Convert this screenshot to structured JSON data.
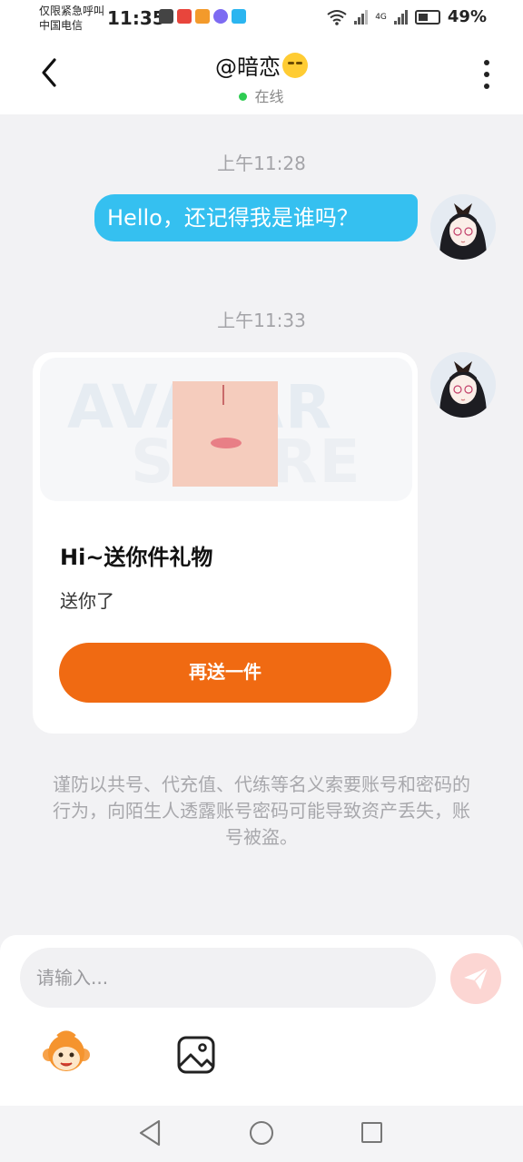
{
  "status_bar": {
    "carrier_line1": "仅限紧急呼叫",
    "carrier_line2": "中国电信",
    "time": "11:35",
    "battery": "49%",
    "network": "4G"
  },
  "header": {
    "title": "@暗恋",
    "status": "在线"
  },
  "messages": [
    {
      "time": "上午11:28",
      "type": "text",
      "text": "Hello，还记得我是谁吗？"
    },
    {
      "time": "上午11:33",
      "type": "gift",
      "banner_watermark_1": "AVATAR",
      "banner_watermark_2": "STORE",
      "title": "Hi~送你件礼物",
      "subtitle": "送你了",
      "button": "再送一件"
    }
  ],
  "notice": "谨防以共号、代充值、代练等名义索要账号和密码的行为，向陌生人透露账号密码可能导致资产丢失，账号被盗。",
  "input": {
    "placeholder": "请输入..."
  },
  "colors": {
    "bubble": "#35c0f0",
    "gift_button": "#f06a12",
    "online_dot": "#2ecc52",
    "send_button": "#fcd6d3"
  },
  "icons": [
    "back-arrow-icon",
    "more-vertical-icon",
    "send-icon",
    "monkey-emoji-icon",
    "image-icon",
    "nav-back-icon",
    "nav-home-icon",
    "nav-recent-icon"
  ]
}
